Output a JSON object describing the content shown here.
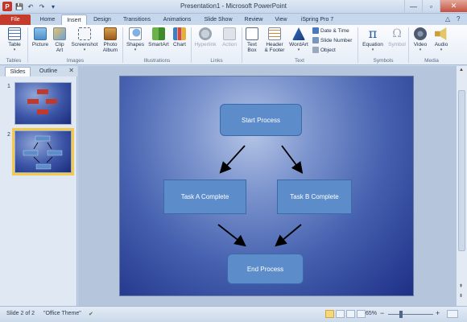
{
  "window": {
    "title": "Presentation1 - Microsoft PowerPoint",
    "app_icon_letter": "P",
    "minimize": "—",
    "restore": "▫",
    "close": "✕"
  },
  "quick_access": {
    "save": "💾",
    "undo": "↶",
    "redo": "↷",
    "more": "▾"
  },
  "tabs": [
    {
      "label": "File"
    },
    {
      "label": "Home"
    },
    {
      "label": "Insert",
      "active": true
    },
    {
      "label": "Design"
    },
    {
      "label": "Transitions"
    },
    {
      "label": "Animations"
    },
    {
      "label": "Slide Show"
    },
    {
      "label": "Review"
    },
    {
      "label": "View"
    },
    {
      "label": "iSpring Pro 7"
    }
  ],
  "tab_controls": {
    "minimize_ribbon": "△",
    "help": "?"
  },
  "ribbon": {
    "groups": {
      "tables": "Tables",
      "images": "Images",
      "illustrations": "Illustrations",
      "links": "Links",
      "text": "Text",
      "symbols": "Symbols",
      "media": "Media"
    },
    "buttons": {
      "table": "Table",
      "picture": "Picture",
      "clip_art_1": "Clip",
      "clip_art_2": "Art",
      "screenshot": "Screenshot",
      "photo_album_1": "Photo",
      "photo_album_2": "Album",
      "shapes": "Shapes",
      "smartart": "SmartArt",
      "chart": "Chart",
      "hyperlink": "Hyperlink",
      "action": "Action",
      "text_box_1": "Text",
      "text_box_2": "Box",
      "header_footer_1": "Header",
      "header_footer_2": "& Footer",
      "wordart": "WordArt",
      "date_time": "Date & Time",
      "slide_number": "Slide Number",
      "object": "Object",
      "equation": "Equation",
      "symbol": "Symbol",
      "video": "Video",
      "audio": "Audio"
    },
    "glyphs": {
      "pi": "π",
      "omega": "Ω"
    }
  },
  "left_pane": {
    "tabs": [
      "Slides",
      "Outline"
    ],
    "close": "✕",
    "thumbnails": [
      {
        "number": "1"
      },
      {
        "number": "2",
        "selected": true
      }
    ]
  },
  "slide": {
    "boxes": {
      "start": "Start Process",
      "task_a": "Task A Complete",
      "task_b": "Task B Complete",
      "end": "End Process"
    }
  },
  "status_bar": {
    "slide_info": "Slide 2 of 2",
    "theme": "\"Office Theme\"",
    "zoom": "65%",
    "zoom_minus": "−",
    "zoom_plus": "+"
  },
  "colors": {
    "file_tab": "#c43a2b",
    "flow_box": "#5d8ccb",
    "slide_dark": "#1d2f86",
    "selection": "#f5c94a"
  }
}
